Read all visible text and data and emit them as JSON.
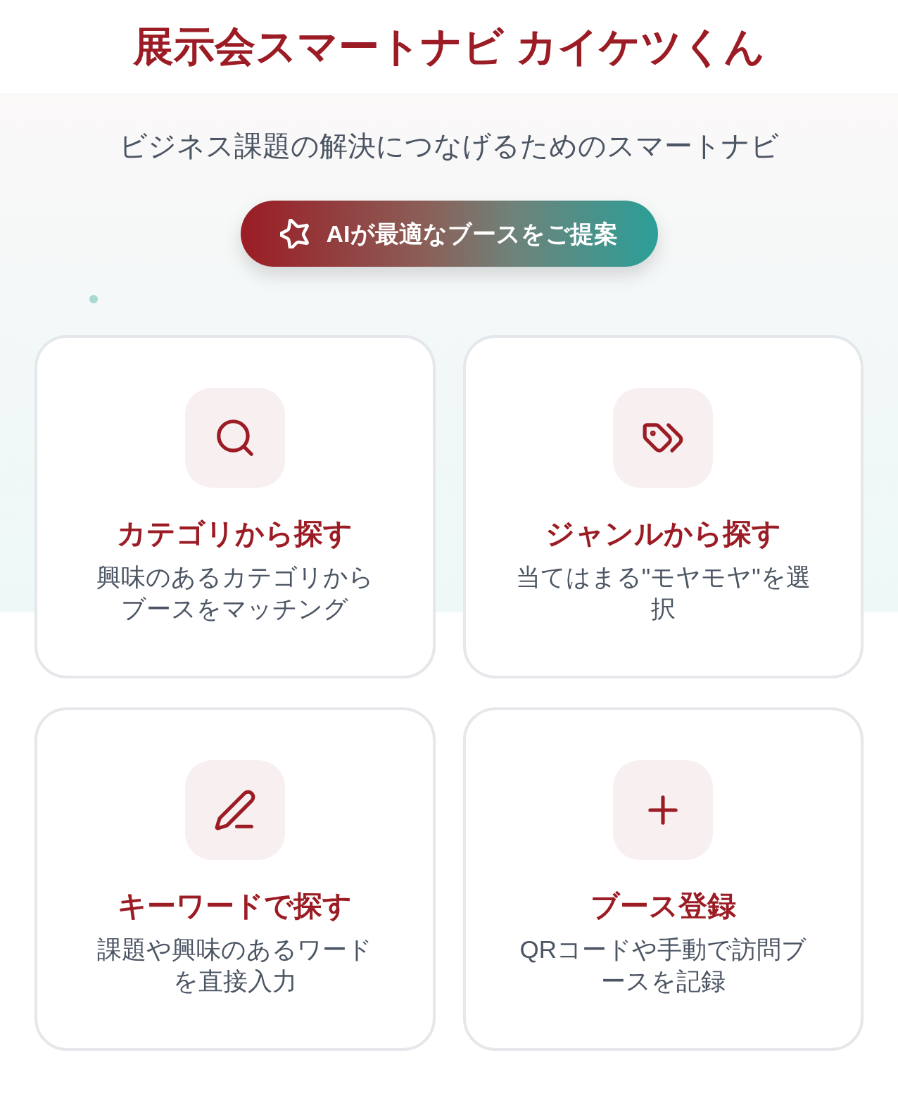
{
  "header": {
    "title": "展示会スマートナビ カイケツくん"
  },
  "hero": {
    "subtitle": "ビジネス課題の解決につなげるためのスマートナビ",
    "ai_button": {
      "label": "AIが最適なブースをご提案"
    }
  },
  "menu_cards": [
    {
      "kind": "search",
      "title": "カテゴリから探す",
      "description": "興味のあるカテゴリからブースをマッチング"
    },
    {
      "kind": "tags",
      "title": "ジャンルから探す",
      "description": "当てはまる\"モヤモヤ\"を選択"
    },
    {
      "kind": "pen",
      "title": "キーワードで探す",
      "description": "課題や興味のあるワードを直接入力"
    },
    {
      "kind": "plus",
      "title": "ブース登録",
      "description": "QRコードや手動で訪問ブースを記録"
    }
  ]
}
